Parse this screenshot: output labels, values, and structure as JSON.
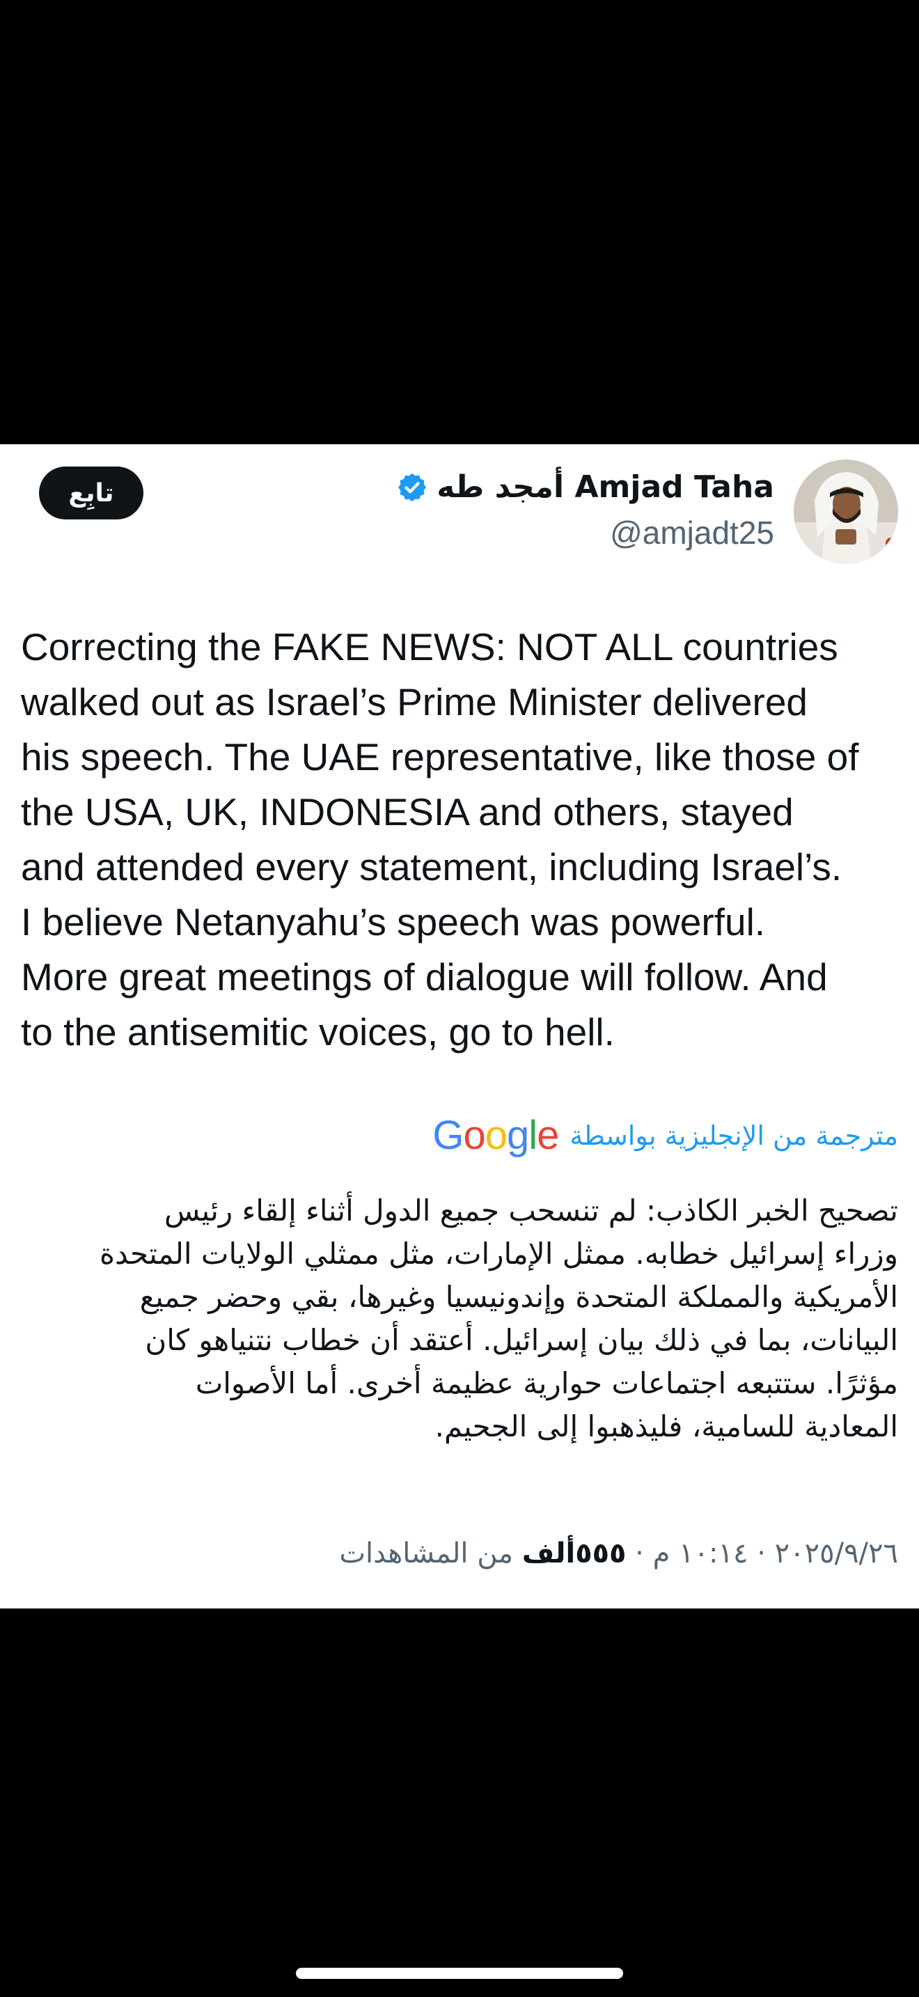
{
  "author": {
    "display_name": "أمجد طه Amjad Taha",
    "handle": "@amjadt25",
    "verified": true
  },
  "follow_button": {
    "label": "تابِع"
  },
  "tweet": {
    "lines": [
      "Correcting the FAKE NEWS: NOT ALL countries",
      "walked out as Israel’s Prime Minister delivered",
      "his speech. The UAE representative, like those of",
      "the USA, UK,  INDONESIA and others, stayed",
      "and attended every statement, including Israel’s.",
      "I believe Netanyahu’s speech was powerful.",
      "More great meetings of dialogue will follow. And",
      "to the antisemitic voices, go to hell."
    ]
  },
  "translation": {
    "label": "مترجمة من الإنجليزية بواسطة",
    "provider": "Google",
    "lines": [
      "تصحيح الخبر الكاذب: لم تنسحب جميع الدول أثناء إلقاء رئيس",
      "وزراء إسرائيل خطابه. ممثل الإمارات، مثل ممثلي الولايات المتحدة",
      "الأمريكية والمملكة المتحدة وإندونيسيا وغيرها، بقي وحضر جميع",
      "البيانات، بما في ذلك بيان إسرائيل. أعتقد أن خطاب نتنياهو كان",
      "مؤثرًا. ستتبعه اجتماعات حوارية عظيمة أخرى. أما الأصوات",
      "المعادية للسامية، فليذهبوا إلى الجحيم."
    ]
  },
  "meta": {
    "date": "٢٠٢٥/٩/٢٦",
    "time": "١٠:١٤ م",
    "views_count": "٥٥٥ألف",
    "views_label": "من المشاهدات",
    "separator": "·"
  },
  "colors": {
    "text": "#0f1419",
    "secondary": "#536471",
    "link": "#1d9bf0",
    "verified": "#1d9bf0"
  }
}
